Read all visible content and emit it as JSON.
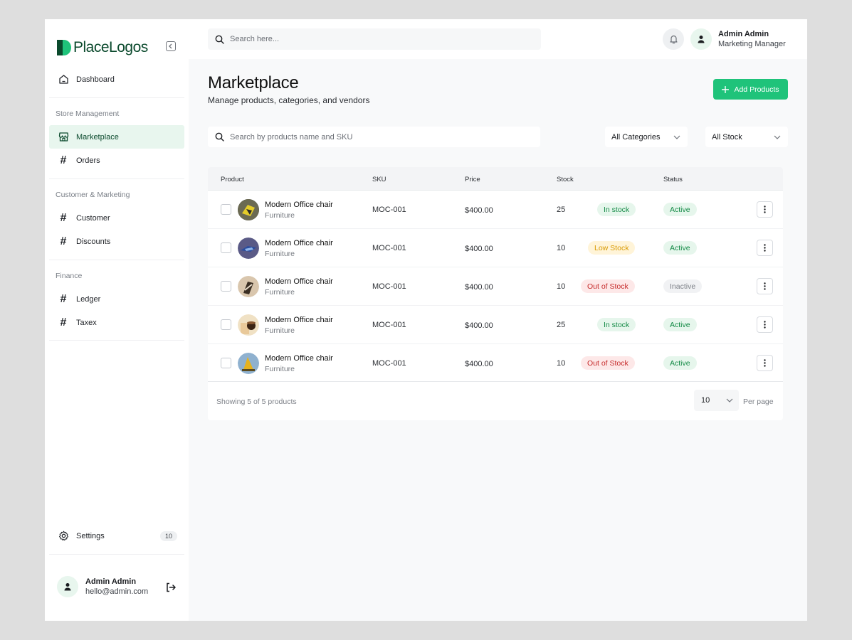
{
  "brand": {
    "name": "PlaceLogos",
    "color": "#0b4a2d",
    "accent": "#1fc37a"
  },
  "sidebar": {
    "dashboard": "Dashboard",
    "sections": [
      {
        "label": "Store Management",
        "items": [
          "Marketplace",
          "Orders"
        ]
      },
      {
        "label": "Customer  & Marketing",
        "items": [
          "Customer",
          "Discounts"
        ]
      },
      {
        "label": "Finance",
        "items": [
          "Ledger",
          "Taxex"
        ]
      }
    ],
    "active_item": "Marketplace",
    "settings": {
      "label": "Settings",
      "badge": "10"
    },
    "user": {
      "name": "Admin Admin",
      "email": "hello@admin.com"
    }
  },
  "topbar": {
    "search_placeholder": "Search here...",
    "user": {
      "name": "Admin Admin",
      "role": "Marketing Manager"
    }
  },
  "page": {
    "title": "Marketplace",
    "subtitle": "Manage products, categories, and vendors",
    "add_button": "Add Products",
    "product_search_placeholder": "Search by products name and SKU",
    "category_filter": "All Categories",
    "stock_filter": "All Stock"
  },
  "table": {
    "columns": [
      "Product",
      "SKU",
      "Price",
      "Stock",
      "Status"
    ],
    "rows": [
      {
        "name": "Modern Office chair",
        "category": "Furniture",
        "sku": "MOC-001",
        "price": "$400.00",
        "stock": "25",
        "stock_status": "In stock",
        "status": "Active"
      },
      {
        "name": "Modern Office chair",
        "category": "Furniture",
        "sku": "MOC-001",
        "price": "$400.00",
        "stock": "10",
        "stock_status": "Low Stock",
        "status": "Active"
      },
      {
        "name": "Modern Office chair",
        "category": "Furniture",
        "sku": "MOC-001",
        "price": "$400.00",
        "stock": "10",
        "stock_status": "Out of Stock",
        "status": "Inactive"
      },
      {
        "name": "Modern Office chair",
        "category": "Furniture",
        "sku": "MOC-001",
        "price": "$400.00",
        "stock": "25",
        "stock_status": "In stock",
        "status": "Active"
      },
      {
        "name": "Modern Office chair",
        "category": "Furniture",
        "sku": "MOC-001",
        "price": "$400.00",
        "stock": "10",
        "stock_status": "Out of Stock",
        "status": "Active"
      }
    ],
    "showing": "Showing 5 of 5 products",
    "per_page_value": "10",
    "per_page_label": "Per page"
  },
  "icons": [
    "logo-icon",
    "collapse-icon",
    "home-icon",
    "store-icon",
    "hash-icon",
    "gear-icon",
    "user-icon",
    "logout-icon",
    "search-icon",
    "bell-icon",
    "plus-icon",
    "chevron-down-icon",
    "more-vertical-icon"
  ]
}
